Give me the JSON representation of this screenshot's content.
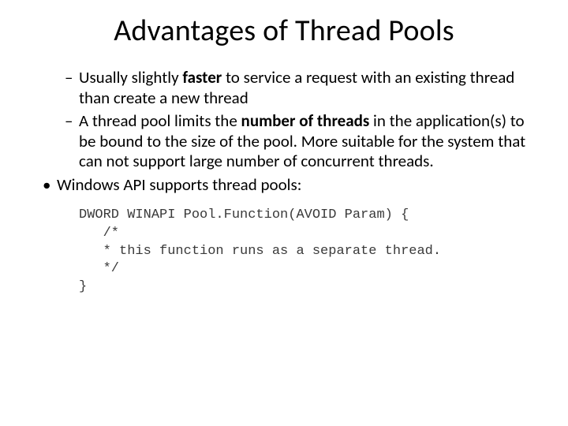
{
  "title": "Advantages of Thread Pools",
  "bullets": {
    "sub": [
      {
        "pre": "Usually slightly ",
        "bold": "faster",
        "post": " to service a request with an existing thread than create a new thread"
      },
      {
        "pre": "A  thread pool limits the ",
        "bold": "number of threads",
        "post": " in the application(s) to be bound to the size of the pool. More suitable for the system that can not support large number of concurrent threads."
      }
    ],
    "main": [
      "Windows API supports thread pools:"
    ]
  },
  "code": {
    "l1": "DWORD WINAPI Pool.Function(AVOID Param) {",
    "l2": "   /*",
    "l3": "   * this function runs as a separate thread.",
    "l4": "   */",
    "l5": "}"
  }
}
